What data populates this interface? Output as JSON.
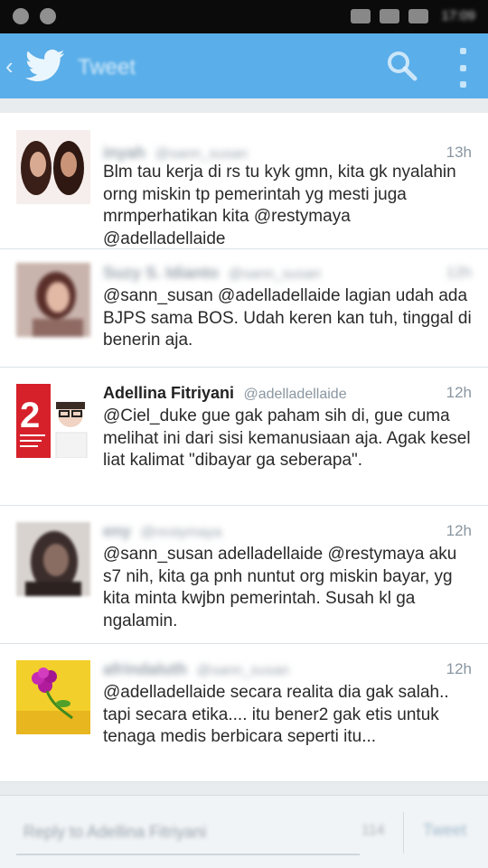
{
  "status_bar": {
    "time": "17:09"
  },
  "app_bar": {
    "title": "Tweet"
  },
  "tweets": [
    {
      "name": "inyah",
      "handle": "@sann_susan",
      "time": "13h",
      "body": "Blm tau kerja di rs tu kyk gmn, kita gk nyalahin orng miskin tp pemerintah yg mesti juga mrmperhatikan kita @restymaya @adelladellaide",
      "blurred_header": true
    },
    {
      "name": "Suzy S. Idianto",
      "handle": "@sann_susan",
      "time": "12h",
      "body": "@sann_susan @adelladellaide lagian udah ada BJPS sama BOS. Udah keren kan tuh, tinggal di benerin aja.",
      "blurred_header": true
    },
    {
      "name": "Adellina Fitriyani",
      "handle": "@adelladellaide",
      "time": "12h",
      "body": "@Ciel_duke gue gak paham sih di, gue cuma melihat ini dari sisi kemanusiaan aja. Agak kesel liat kalimat \"dibayar ga seberapa\".",
      "blurred_header": false
    },
    {
      "name": "eny",
      "handle": "@restymaya",
      "time": "12h",
      "body": "@sann_susan adelladellaide @restymaya aku s7 nih, kita ga pnh nuntut org miskin bayar, yg kita minta kwjbn pemerintah. Susah kl ga ngalamin.",
      "blurred_header": true
    },
    {
      "name": "afrindaluth",
      "handle": "@sann_susan",
      "time": "12h",
      "body": "@adelladellaide secara realita dia gak salah.. tapi secara etika.... itu bener2 gak etis untuk tenaga medis berbicara seperti itu...",
      "blurred_header": true
    }
  ],
  "compose": {
    "placeholder": "Reply to Adellina Fitriyani",
    "char_count": "114",
    "reply_label": "Tweet"
  },
  "colors": {
    "accent": "#5aaee9",
    "background": "#e8ecef"
  },
  "icons": [
    "back-icon",
    "twitter-bird-icon",
    "search-icon",
    "overflow-menu-icon"
  ]
}
